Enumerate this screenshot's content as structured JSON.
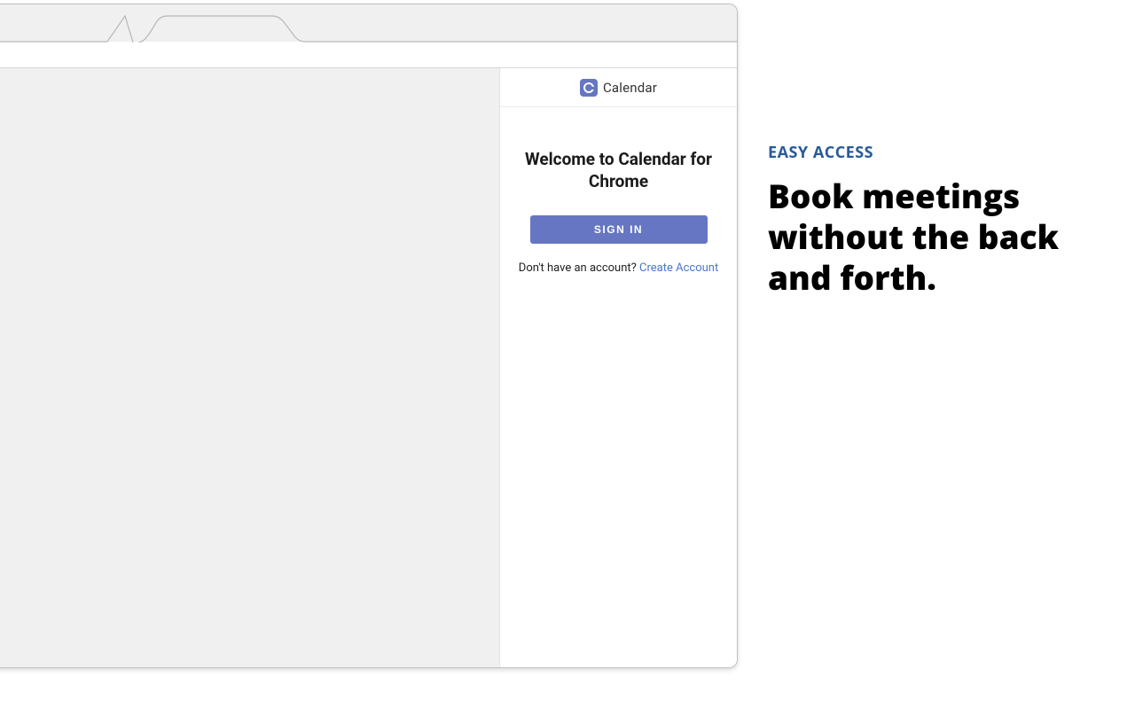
{
  "panel": {
    "brand": "Calendar",
    "welcome": "Welcome to Calendar for Chrome",
    "signin_label": "SIGN IN",
    "no_account_prompt": "Don't have an account? ",
    "create_account_label": "Create Account"
  },
  "marketing": {
    "eyebrow": "EASY ACCESS",
    "headline": "Book meetings without the back and forth."
  },
  "colors": {
    "accent": "#6676c2",
    "link": "#4a76c9",
    "eyebrow": "#2a5b99"
  }
}
